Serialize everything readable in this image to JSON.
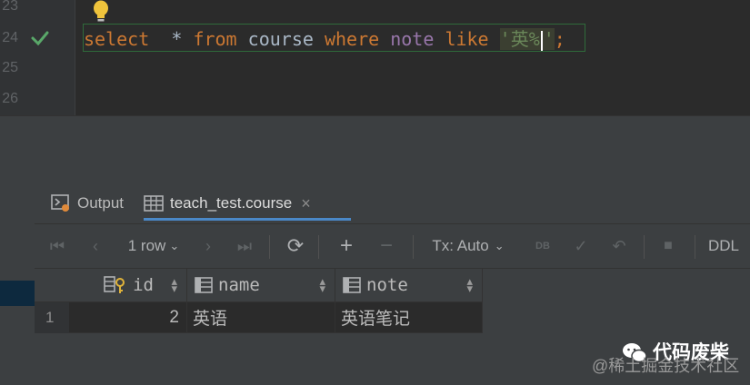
{
  "editor": {
    "line_numbers": [
      "23",
      "24",
      "25",
      "26"
    ],
    "code": {
      "kw_select": "select",
      "star": "*",
      "kw_from": "from",
      "table": "course",
      "kw_where": "where",
      "column": "note",
      "kw_like": "like",
      "str_open": "'英%",
      "str_close": "'",
      "semicolon": ";"
    }
  },
  "tabs": {
    "output": "Output",
    "course": "teach_test.course",
    "close": "×"
  },
  "toolbar": {
    "rows": "1 row",
    "tx": "Tx: Auto",
    "ddl": "DDL",
    "db_badge": "DB"
  },
  "grid": {
    "columns": [
      "id",
      "name",
      "note"
    ],
    "rows": [
      {
        "row_number": "1",
        "id": "2",
        "name": "英语",
        "note": "英语笔记"
      }
    ]
  },
  "watermark": {
    "name": "代码废柴",
    "sub": "@稀土掘金技术社区"
  },
  "colors": {
    "keyword": "#cc7832",
    "column": "#9876aa",
    "string": "#6a8759",
    "check": "#59a869",
    "bulb": "#f0c43c",
    "tab_underline": "#4a88c7"
  }
}
